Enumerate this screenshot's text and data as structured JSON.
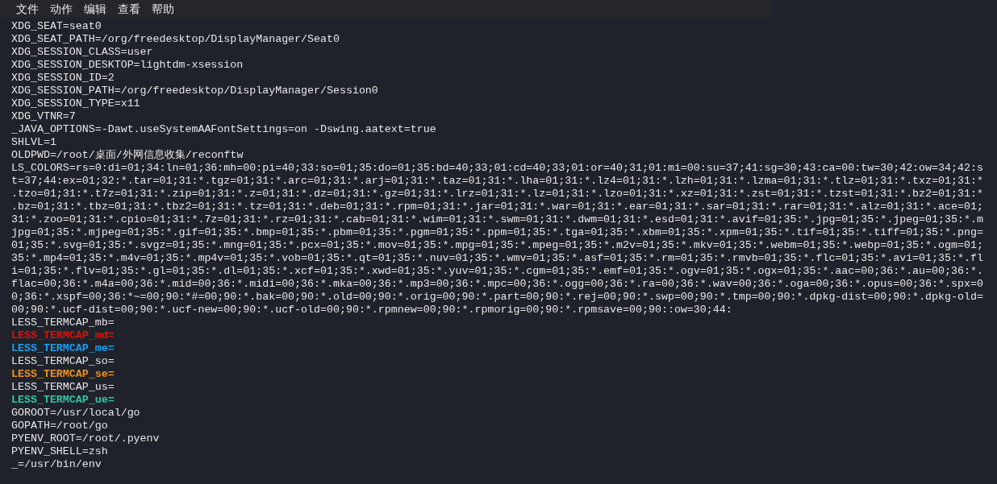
{
  "menu_bar": {
    "items": [
      "文件",
      "动作",
      "编辑",
      "查看",
      "帮助"
    ]
  },
  "terminal": {
    "lines": [
      {
        "text": "XDG_SEAT=seat0"
      },
      {
        "text": "XDG_SEAT_PATH=/org/freedesktop/DisplayManager/Seat0"
      },
      {
        "text": "XDG_SESSION_CLASS=user"
      },
      {
        "text": "XDG_SESSION_DESKTOP=lightdm-xsession"
      },
      {
        "text": "XDG_SESSION_ID=2"
      },
      {
        "text": "XDG_SESSION_PATH=/org/freedesktop/DisplayManager/Session0"
      },
      {
        "text": "XDG_SESSION_TYPE=x11"
      },
      {
        "text": "XDG_VTNR=7"
      },
      {
        "text": "_JAVA_OPTIONS=-Dawt.useSystemAAFontSettings=on -Dswing.aatext=true"
      },
      {
        "text": "SHLVL=1"
      },
      {
        "text": "OLDPWD=/root/桌面/外网信息收集/reconftw"
      },
      {
        "text": "LS_COLORS=rs=0:di=01;34:ln=01;36:mh=00:pi=40;33:so=01;35:do=01;35:bd=40;33;01:cd=40;33;01:or=40;31;01:mi=00:su=37;41:sg=30;43:ca=00:tw=30;42:ow=34;42:s"
      },
      {
        "text": "t=37;44:ex=01;32:*.tar=01;31:*.tgz=01;31:*.arc=01;31:*.arj=01;31:*.taz=01;31:*.lha=01;31:*.lz4=01;31:*.lzh=01;31:*.lzma=01;31:*.tlz=01;31:*.txz=01;31:*"
      },
      {
        "text": ".tzo=01;31:*.t7z=01;31:*.zip=01;31:*.z=01;31:*.dz=01;31:*.gz=01;31:*.lrz=01;31:*.lz=01;31:*.lzo=01;31:*.xz=01;31:*.zst=01;31:*.tzst=01;31:*.bz2=01;31:*"
      },
      {
        "text": ".bz=01;31:*.tbz=01;31:*.tbz2=01;31:*.tz=01;31:*.deb=01;31:*.rpm=01;31:*.jar=01;31:*.war=01;31:*.ear=01;31:*.sar=01;31:*.rar=01;31:*.alz=01;31:*.ace=01;"
      },
      {
        "text": "31:*.zoo=01;31:*.cpio=01;31:*.7z=01;31:*.rz=01;31:*.cab=01;31:*.wim=01;31:*.swm=01;31:*.dwm=01;31:*.esd=01;31:*.avif=01;35:*.jpg=01;35:*.jpeg=01;35:*.m"
      },
      {
        "text": "jpg=01;35:*.mjpeg=01;35:*.gif=01;35:*.bmp=01;35:*.pbm=01;35:*.pgm=01;35:*.ppm=01;35:*.tga=01;35:*.xbm=01;35:*.xpm=01;35:*.tif=01;35:*.tiff=01;35:*.png="
      },
      {
        "text": "01;35:*.svg=01;35:*.svgz=01;35:*.mng=01;35:*.pcx=01;35:*.mov=01;35:*.mpg=01;35:*.mpeg=01;35:*.m2v=01;35:*.mkv=01;35:*.webm=01;35:*.webp=01;35:*.ogm=01;"
      },
      {
        "text": "35:*.mp4=01;35:*.m4v=01;35:*.mp4v=01;35:*.vob=01;35:*.qt=01;35:*.nuv=01;35:*.wmv=01;35:*.asf=01;35:*.rm=01;35:*.rmvb=01;35:*.flc=01;35:*.avi=01;35:*.fl"
      },
      {
        "text": "i=01;35:*.flv=01;35:*.gl=01;35:*.dl=01;35:*.xcf=01;35:*.xwd=01;35:*.yuv=01;35:*.cgm=01;35:*.emf=01;35:*.ogv=01;35:*.ogx=01;35:*.aac=00;36:*.au=00;36:*."
      },
      {
        "text": "flac=00;36:*.m4a=00;36:*.mid=00;36:*.midi=00;36:*.mka=00;36:*.mp3=00;36:*.mpc=00;36:*.ogg=00;36:*.ra=00;36:*.wav=00;36:*.oga=00;36:*.opus=00;36:*.spx=0"
      },
      {
        "text": "0;36:*.xspf=00;36:*~=00;90:*#=00;90:*.bak=00;90:*.old=00;90:*.orig=00;90:*.part=00;90:*.rej=00;90:*.swp=00;90:*.tmp=00;90:*.dpkg-dist=00;90:*.dpkg-old="
      },
      {
        "text": "00;90:*.ucf-dist=00;90:*.ucf-new=00;90:*.ucf-old=00;90:*.rpmnew=00;90:*.rpmorig=00;90:*.rpmsave=00;90::ow=30;44:"
      },
      {
        "text": "LESS_TERMCAP_mb="
      },
      {
        "text": "LESS_TERMCAP_md=",
        "color": "#e0100f"
      },
      {
        "text": "LESS_TERMCAP_me=",
        "color": "#1a9ff0"
      },
      {
        "text": "LESS_TERMCAP_so="
      },
      {
        "text": "LESS_TERMCAP_se=",
        "color": "#f0901a"
      },
      {
        "text": "LESS_TERMCAP_us="
      },
      {
        "text": "LESS_TERMCAP_ue=",
        "color": "#2fc7a6"
      },
      {
        "text": "GOROOT=/usr/local/go"
      },
      {
        "text": "GOPATH=/root/go"
      },
      {
        "text": "PYENV_ROOT=/root/.pyenv"
      },
      {
        "text": "PYENV_SHELL=zsh"
      },
      {
        "text": "_=/usr/bin/env"
      }
    ]
  }
}
